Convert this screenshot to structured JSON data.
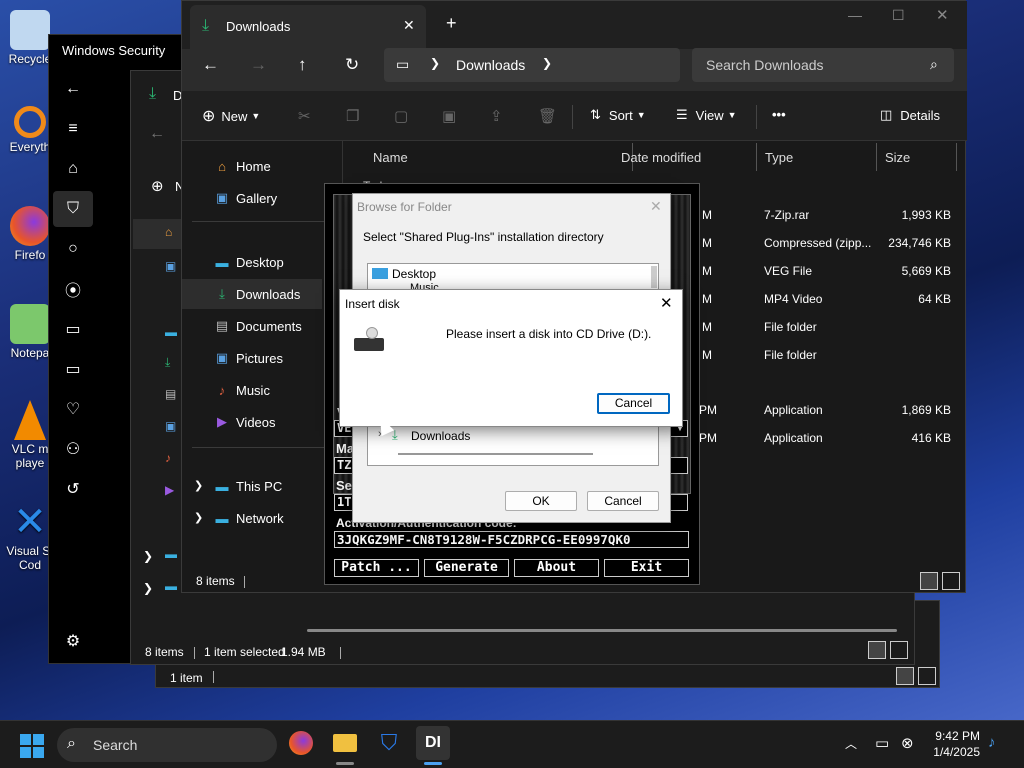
{
  "desktop": {
    "icons": [
      {
        "label": "Recycle",
        "color": "#c0d8f0",
        "glyph": "recycle-bin-icon"
      },
      {
        "label": "Everyth",
        "color": "#f08a1a",
        "glyph": "search-icon"
      },
      {
        "label": "Firefo",
        "color": "#e8542a",
        "glyph": "firefox-icon"
      },
      {
        "label": "Notepa",
        "color": "#7cc86c",
        "glyph": "notepad-icon"
      },
      {
        "label": "VLC m\nplaye",
        "color": "#f28a00",
        "glyph": "vlc-icon"
      },
      {
        "label": "Visual St\nCod",
        "color": "#2a8ae8",
        "glyph": "vscode-icon"
      }
    ]
  },
  "security": {
    "title": "Windows Security"
  },
  "bg_explorer": {
    "tab_icon_text": "D",
    "new_prefix": "N",
    "status": {
      "items": "8 items",
      "selected": "1 item selected",
      "size": "1.94 MB"
    }
  },
  "back_explorer": {
    "status": {
      "items": "1 item"
    }
  },
  "explorer": {
    "tab_title": "Downloads",
    "address": {
      "segment": "Downloads"
    },
    "search_placeholder": "Search Downloads",
    "toolbar": {
      "new": "New",
      "sort": "Sort",
      "view": "View",
      "more": "•••",
      "details": "Details"
    },
    "nav": [
      "Home",
      "Gallery",
      "Desktop",
      "Downloads",
      "Documents",
      "Pictures",
      "Music",
      "Videos",
      "This PC",
      "Network"
    ],
    "columns": {
      "name": "Name",
      "date": "Date modified",
      "type": "Type",
      "size": "Size"
    },
    "rows": [
      {
        "date": "M",
        "type": "7-Zip.rar",
        "size": "1,993 KB"
      },
      {
        "date": "M",
        "type": "Compressed (zipp...",
        "size": "234,746 KB"
      },
      {
        "date": "M",
        "type": "VEG File",
        "size": "5,669 KB"
      },
      {
        "date": "M",
        "type": "MP4 Video",
        "size": "64 KB"
      },
      {
        "date": "M",
        "type": "File folder",
        "size": ""
      },
      {
        "date": "M",
        "type": "File folder",
        "size": ""
      },
      {
        "date": "PM",
        "type": "Application",
        "size": "1,869 KB"
      },
      {
        "date": "PM",
        "type": "Application",
        "size": "416 KB"
      }
    ],
    "partial_name": "Tod",
    "status": {
      "items": "8 items"
    }
  },
  "keygen": {
    "label1": "VE",
    "label2": "Ma",
    "label3": "Se",
    "label4": "Activation/Authentication code:",
    "field_short1": "TZ",
    "field_short2": "1T",
    "code": "3JQKGZ9MF-CN8T9128W-F5CZDRPCG-EE0997QK0",
    "buttons": [
      "Patch ...",
      "Generate",
      "About",
      "Exit"
    ]
  },
  "browse": {
    "title": "Browse for Folder",
    "prompt": "Select \"Shared Plug-Ins\" installation directory",
    "tree": {
      "desktop": "Desktop",
      "music": "Music",
      "downloads": "Downloads"
    },
    "ok": "OK",
    "cancel": "Cancel"
  },
  "insert": {
    "title": "Insert disk",
    "message": "Please insert a disk into CD Drive (D:).",
    "cancel": "Cancel"
  },
  "taskbar": {
    "search": "Search",
    "time": "9:42 PM",
    "date": "1/4/2025"
  }
}
